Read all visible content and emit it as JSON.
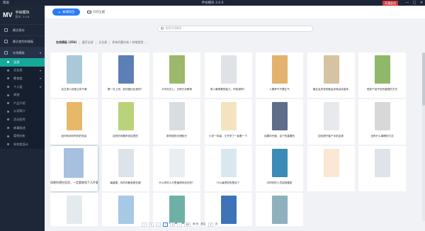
{
  "titlebar": {
    "help": "帮助",
    "title": "手绘模块 3.0.6",
    "vip": "开通会员",
    "min": "—",
    "max": "□",
    "close": "✕"
  },
  "sidebar": {
    "logo": {
      "mark": "MV",
      "name": "手绘模块",
      "version": "版本: 3.0.6"
    },
    "items": [
      {
        "label": "最近保存",
        "type": "item"
      },
      {
        "label": "最近使用的模板",
        "type": "item"
      },
      {
        "label": "在线模板",
        "type": "item",
        "open": true
      },
      {
        "label": "全部",
        "type": "sub",
        "active": true
      },
      {
        "label": "企业类",
        "type": "sub",
        "chev": true
      },
      {
        "label": "教育类",
        "type": "sub",
        "chev": true
      },
      {
        "label": "个人类",
        "type": "sub",
        "chev": true
      },
      {
        "label": "其他",
        "type": "sub"
      },
      {
        "label": "产品介绍",
        "type": "sub"
      },
      {
        "label": "公司简介",
        "type": "sub"
      },
      {
        "label": "活动宣传",
        "type": "sub"
      },
      {
        "label": "故事叙述",
        "type": "sub"
      },
      {
        "label": "案例分析",
        "type": "sub"
      },
      {
        "label": "如何类设计",
        "type": "sub"
      }
    ]
  },
  "toolbar": {
    "new_label": "新建项目",
    "open_label": "打开工程"
  },
  "search": {
    "placeholder": "搜索在线模板"
  },
  "filter": {
    "label": "在线模板 (356)",
    "chips": [
      "展开全部",
      "企业类",
      "如何问题分析 / 其他类型 ..."
    ]
  },
  "cards": [
    {
      "caption": "这五类人找他让你不满",
      "color": "#a9c9d8"
    },
    {
      "caption": "第一天上班，如何做出优良的？",
      "color": "#5b7fb6"
    },
    {
      "caption": "今天你去上，五种方法教育",
      "color": "#9cb86a"
    },
    {
      "caption": "男人最想要的能力，你知道吗？",
      "color": "#dfe2e6"
    },
    {
      "caption": "人要争气不要生气",
      "color": "#e3b26e"
    },
    {
      "caption": "聚友会庆祝的聚会庆典活动宣传",
      "color": "#d5c3a2"
    },
    {
      "caption": "很多产品不仅的重视的方式",
      "color": "#8fb86a"
    },
    {
      "caption": "如何利用你所的好机会",
      "color": "#e8b86a"
    },
    {
      "caption": "这样的问题来到这里的",
      "color": "#b9d37a"
    },
    {
      "caption": "那时候的仓储知识",
      "color": "#d8dde2"
    },
    {
      "caption": "小学一年级，又开学了一起看一下",
      "color": "#f4e3c0"
    },
    {
      "caption": "如果你仔细，这个的重要的",
      "color": "#5f6d8a"
    },
    {
      "caption": "如何提升客户手机品类",
      "color": "#e7e9ec"
    },
    {
      "caption": "没有什么事情的方法",
      "color": "#d8d8d8"
    },
    {
      "caption": "如果你想在投资，一定要做到下几件事",
      "color": "#a7c0e0",
      "hover": true
    },
    {
      "caption": "最重要，你的判断就是关键",
      "color": "#dde3ea"
    },
    {
      "caption": "什么样的人才是值得你信任的？",
      "color": "#e9eef2"
    },
    {
      "caption": "什么值得你的是这个",
      "color": "#d9e8ef"
    },
    {
      "caption": "中药材的人员结构模型",
      "color": "#3b8bb6"
    },
    {
      "caption": "",
      "color": "#fbe8d4"
    },
    {
      "caption": "",
      "color": "#dfe4ea"
    },
    {
      "caption": "",
      "color": "#e4ebef"
    },
    {
      "caption": "",
      "color": "#a8c9e6"
    },
    {
      "caption": "",
      "color": "#6fb0a6"
    },
    {
      "caption": "",
      "color": "#3f73b8"
    },
    {
      "caption": "",
      "color": "#8fb0bd"
    }
  ],
  "pager": {
    "prev": "‹",
    "pages": [
      "1",
      "...",
      "1",
      "2"
    ],
    "next": "›",
    "size": "60",
    "size_unit": "条/页",
    "goto": "前往",
    "goto_page": "1",
    "goto_unit": "页"
  }
}
